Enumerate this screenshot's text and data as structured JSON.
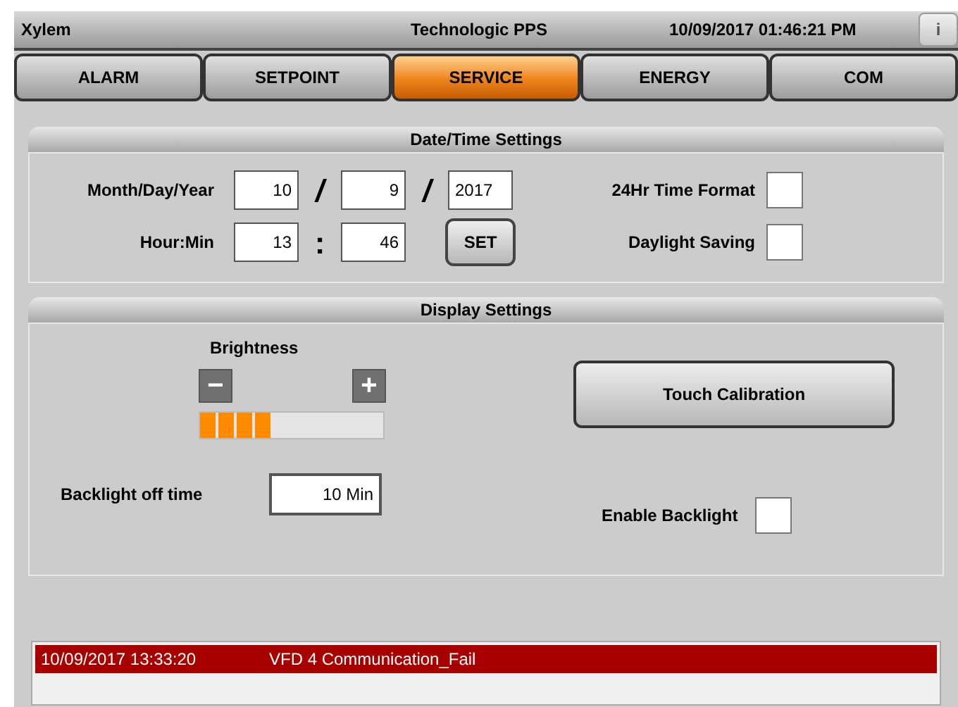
{
  "title_bar": {
    "left": "Xylem",
    "center": "Technologic PPS",
    "datetime": "10/09/2017 01:46:21 PM",
    "info_button": "i"
  },
  "tabs": [
    {
      "label": "ALARM",
      "selected": false
    },
    {
      "label": "SETPOINT",
      "selected": false
    },
    {
      "label": "SERVICE",
      "selected": true
    },
    {
      "label": "ENERGY",
      "selected": false
    },
    {
      "label": "COM",
      "selected": false
    }
  ],
  "date_time_settings": {
    "title": "Date/Time Settings",
    "date_label": "Month/Day/Year",
    "month": "10",
    "date_sep_1": "/",
    "day": "9",
    "date_sep_2": "/",
    "year": "2017",
    "time_label": "Hour:Min",
    "hour": "13",
    "time_sep": ":",
    "minute": "46",
    "set_button": "SET",
    "options": [
      {
        "label": "24Hr Time Format",
        "checked": false
      },
      {
        "label": "Daylight Saving",
        "checked": false
      }
    ]
  },
  "display_settings": {
    "title": "Display Settings",
    "brightness_label": "Brightness",
    "decrease": "−",
    "increase": "+",
    "brightness": {
      "level": 0.4
    },
    "touch_calibration": "Touch Calibration",
    "backlight_label": "Backlight off time",
    "backlight_value": "10 Min",
    "enable_backlight": {
      "label": "Enable Backlight",
      "checked": false
    }
  },
  "alarms": [
    {
      "time": "10/09/2017 13:33:20",
      "message": "VFD 4 Communication_Fail",
      "selected": true
    }
  ]
}
